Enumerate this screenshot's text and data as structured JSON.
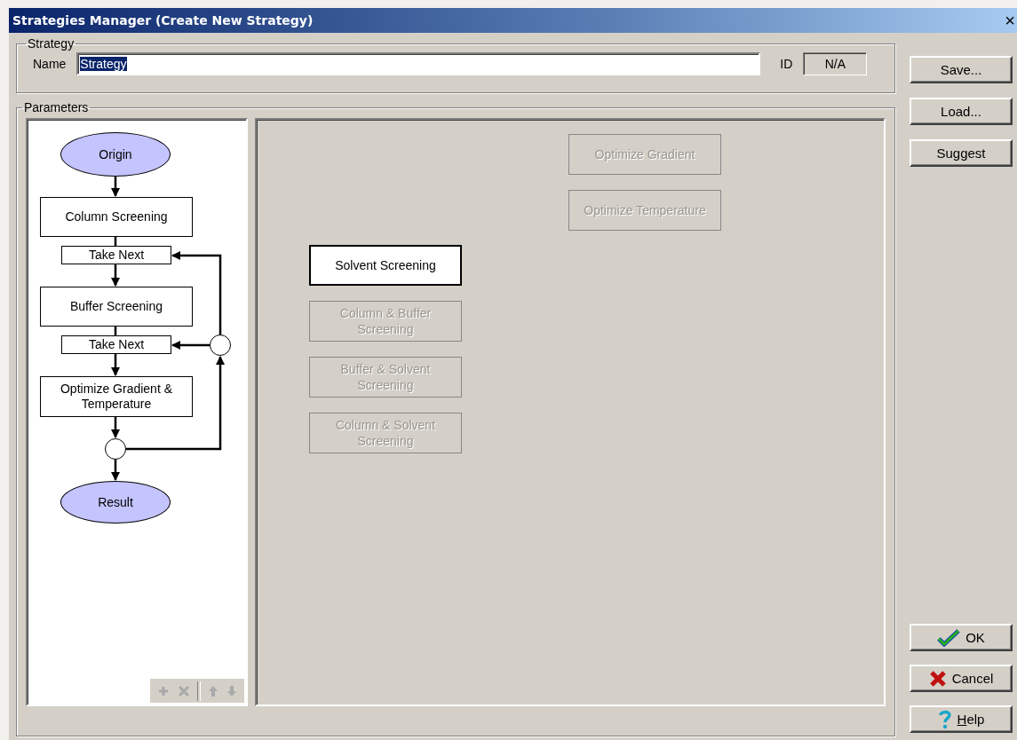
{
  "window": {
    "title": "Strategies Manager (Create New Strategy)",
    "close": "×"
  },
  "strategy": {
    "legend": "Strategy",
    "name_label": "Name",
    "name_value": "Strategy",
    "name_selected": true,
    "id_label": "ID",
    "id_value": "N/A"
  },
  "parameters": {
    "legend": "Parameters",
    "flow": {
      "nodes": [
        {
          "kind": "terminal",
          "text": "Origin"
        },
        {
          "kind": "process",
          "text": "Column Screening"
        },
        {
          "kind": "step",
          "text": "Take Next"
        },
        {
          "kind": "process",
          "text": "Buffer Screening"
        },
        {
          "kind": "step",
          "text": "Take Next"
        },
        {
          "kind": "process",
          "text": "Optimize Gradient & Temperature"
        },
        {
          "kind": "decision"
        },
        {
          "kind": "terminal",
          "text": "Result"
        },
        {
          "kind": "decision"
        }
      ]
    },
    "steps": [
      {
        "text": "Optimize Gradient",
        "disabled": true
      },
      {
        "text": "Optimize Temperature",
        "disabled": true
      },
      {
        "text": "Solvent Screening",
        "disabled": false
      },
      {
        "text": "Column & Buffer Screening",
        "disabled": true
      },
      {
        "text": "Buffer & Solvent Screening",
        "disabled": true
      },
      {
        "text": "Column & Solvent Screening",
        "disabled": true
      }
    ]
  },
  "side_buttons": [
    {
      "label": "Save...",
      "kind": "plain"
    },
    {
      "label": "Load...",
      "kind": "plain"
    },
    {
      "label": "Suggest",
      "kind": "plain"
    },
    {
      "label": "OK",
      "kind": "ok"
    },
    {
      "label": "Cancel",
      "kind": "cancel"
    },
    {
      "label": "Help",
      "kind": "help"
    }
  ]
}
